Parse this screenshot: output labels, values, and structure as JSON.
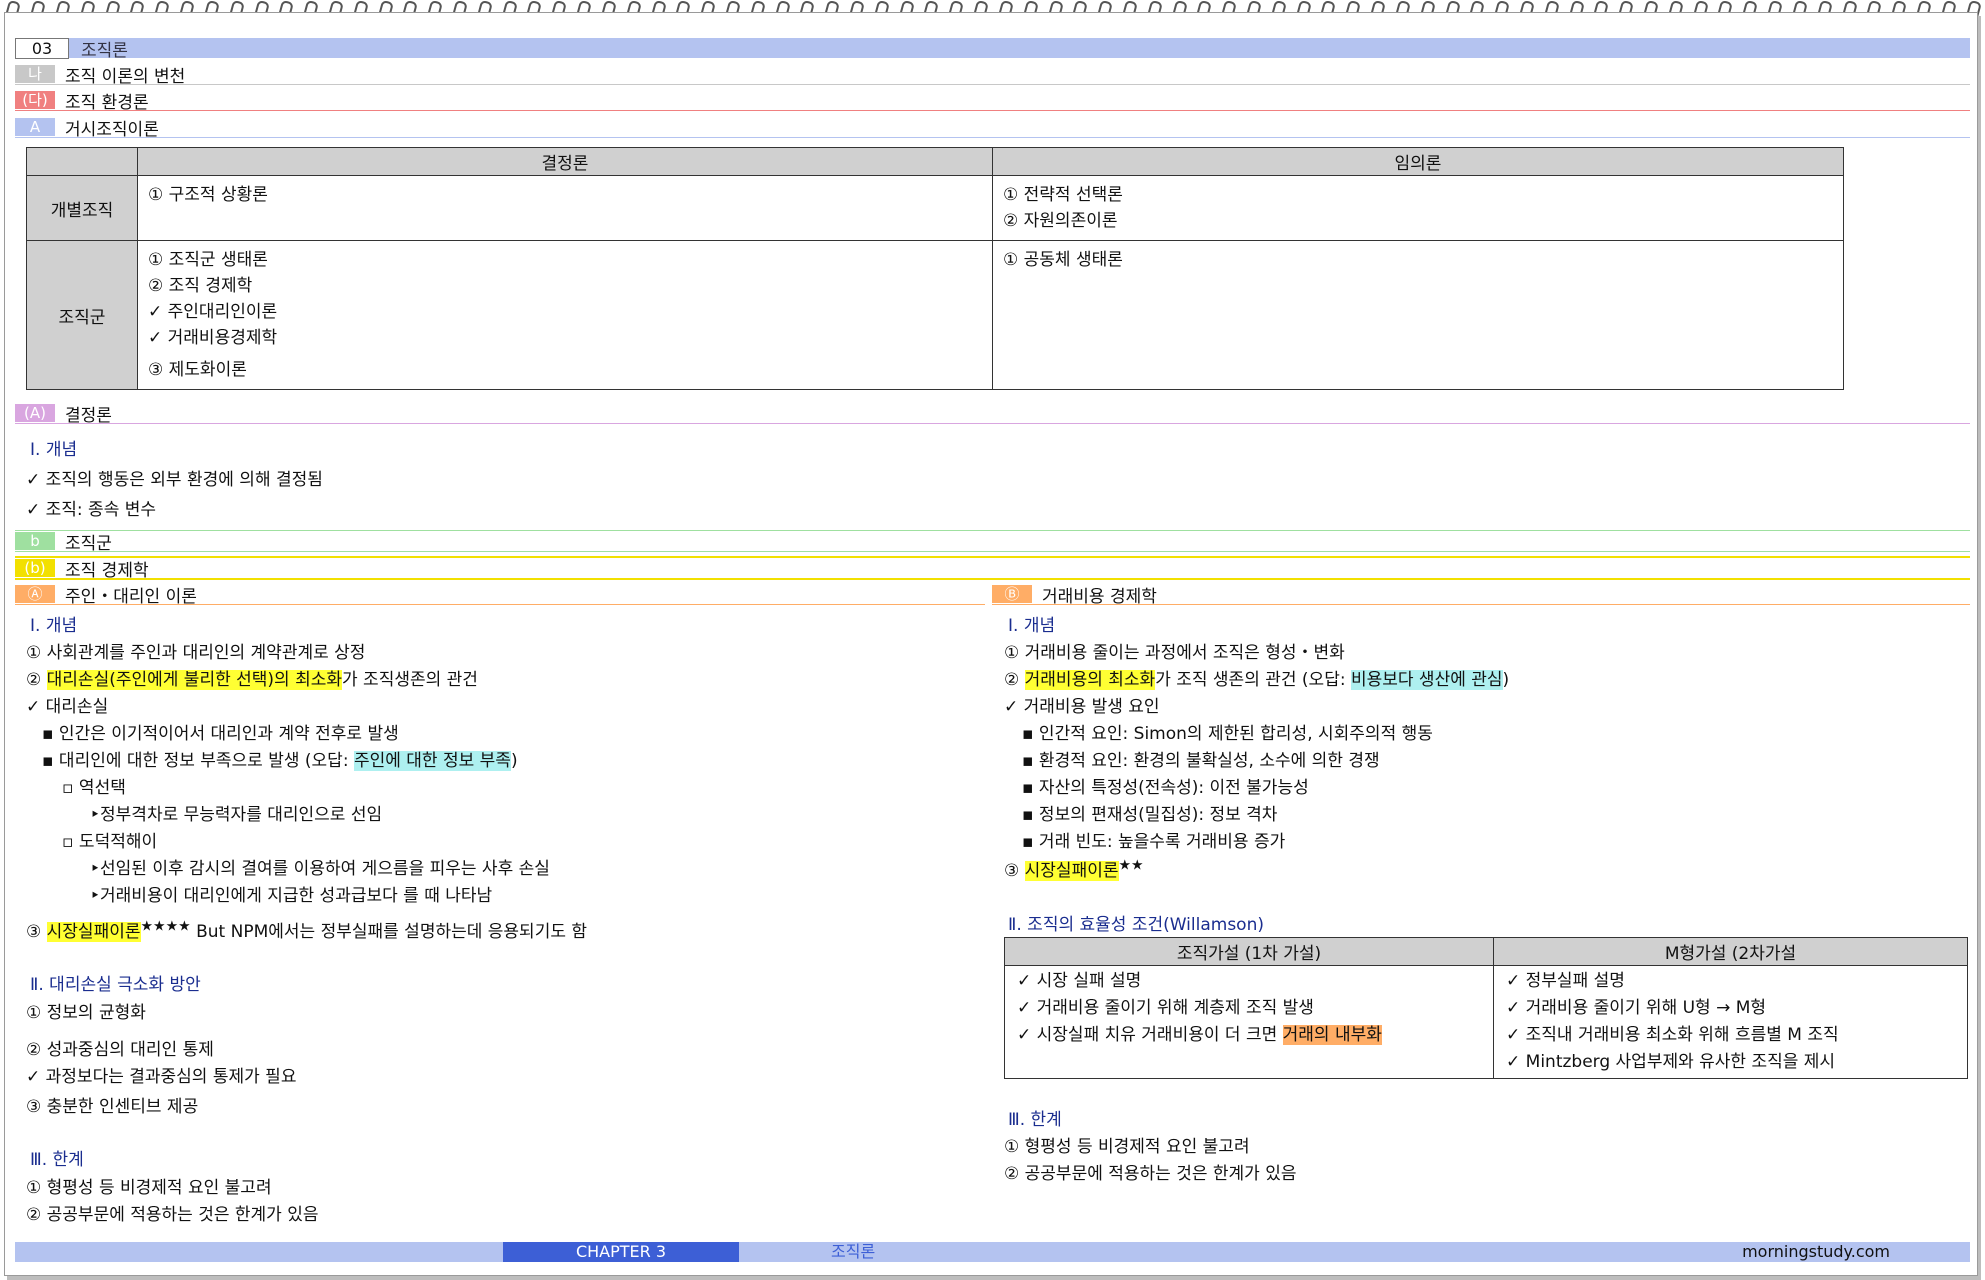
{
  "header": {
    "chapter_num": "03",
    "chapter_title": "조직론",
    "l2_tag": "나",
    "l2_title": "조직 이론의 변천",
    "l3_tag": "(다)",
    "l3_title": "조직 환경론",
    "l4_tag": "A",
    "l4_title": "거시조직이론"
  },
  "macro_table": {
    "col1": "결정론",
    "col2": "임의론",
    "row1_label": "개별조직",
    "row1_c1": [
      "① 구조적 상황론"
    ],
    "row1_c2": [
      "① 전략적 선택론",
      "② 자원의존이론"
    ],
    "row2_label": "조직군",
    "row2_c1": [
      "① 조직군 생태론",
      "② 조직 경제학",
      "✓ 주인대리인이론",
      "✓ 거래비용경제학",
      "③ 제도화이론"
    ],
    "row2_c2": [
      "① 공동체 생태론"
    ]
  },
  "determinism": {
    "tag": "(A)",
    "title": "결정론",
    "sec1": "Ⅰ. 개념",
    "items": [
      "✓ 조직의 행동은 외부 환경에 의해 결정됨",
      "✓ 조직: 종속 변수"
    ]
  },
  "popgroup": {
    "tag": "b",
    "title": "조직군"
  },
  "orgecon": {
    "tag": "(b)",
    "title": "조직 경제학"
  },
  "left": {
    "tag": "Ⓐ",
    "title": "주인・대리인 이론",
    "sec1": "Ⅰ. 개념",
    "l1": "① 사회관계를 주인과 대리인의 계약관계로 상정",
    "l2_pre": "② ",
    "l2_hl": "대리손실(주인에게 불리한 선택)의 최소화",
    "l2_post": "가 조직생존의 관건",
    "l3": "✓ 대리손실",
    "l4": "▪ 인간은 이기적이어서 대리인과 계약 전후로 발생",
    "l5_pre": "▪ 대리인에 대한 정보 부족으로 발생 (오답: ",
    "l5_hl": "주인에 대한 정보 부족",
    "l5_post": ")",
    "l6": "▫ 역선택",
    "l7": "‣정부격차로 무능력자를 대리인으로 선임",
    "l8": "▫ 도덕적해이",
    "l9": "‣선임된 이후 감시의 결여를 이용하여 게으름을 피우는 사후 손실",
    "l10": "‣거래비용이 대리인에게 지급한 성과급보다 를 때 나타남",
    "l11_pre": "③ ",
    "l11_hl": "시장실패이론",
    "l11_star": "★★★★",
    "l11_post": " But NPM에서는 정부실패를 설명하는데 응용되기도 함",
    "sec2": "Ⅱ. 대리손실 극소화 방안",
    "m1": "① 정보의 균형화",
    "m2": "② 성과중심의 대리인 통제",
    "m3": "✓ 과정보다는 결과중심의 통제가 필요",
    "m4": "③ 충분한 인센티브 제공",
    "sec3": "Ⅲ. 한계",
    "n1": "① 형평성 등 비경제적 요인 불고려",
    "n2": "② 공공부문에 적용하는 것은 한계가 있음"
  },
  "right": {
    "tag": "Ⓑ",
    "title": "거래비용 경제학",
    "sec1": "Ⅰ. 개념",
    "l1": "① 거래비용 줄이는 과정에서 조직은 형성・변화",
    "l2_pre": "② ",
    "l2_hl": "거래비용의 최소화",
    "l2_mid": "가 조직 생존의 관건 (오답: ",
    "l2_hl2": "비용보다 생산에 관심",
    "l2_post": ")",
    "l3": "✓ 거래비용 발생 요인",
    "l4": "▪ 인간적 요인: Simon의 제한된 합리성, 시회주의적 행동",
    "l5": "▪ 환경적 요인: 환경의 불확실성, 소수에 의한 경쟁",
    "l6": "▪ 자산의 특정성(전속성): 이전 불가능성",
    "l7": "▪ 정보의 편재성(밀집성): 정보 격차",
    "l8": "▪ 거래 빈도: 높을수록 거래비용 증가",
    "l9_pre": "③ ",
    "l9_hl": "시장실패이론",
    "l9_star": "★★",
    "sec2": "Ⅱ. 조직의 효율성 조건(Willamson)",
    "t_h1": "조직가설 (1차 가설)",
    "t_h2": "M형가설 (2차가설",
    "t_c1": [
      "✓ 시장 실패 설명",
      "✓ 거래비용 줄이기 위해 계층제 조직 발생"
    ],
    "t_c1_last_pre": "✓ 시장실패 치유 거래비용이 더 크면 ",
    "t_c1_last_hl": "거래의 내부화",
    "t_c2": [
      "✓ 정부실패 설명",
      "✓ 거래비용 줄이기 위해 U형 → M형",
      "✓ 조직내 거래비용 최소화 위해 흐름별 M 조직",
      "✓ Mintzberg 사업부제와 유사한 조직을 제시"
    ],
    "sec3": "Ⅲ. 한계",
    "n1": "① 형평성 등 비경제적 요인 불고려",
    "n2": "② 공공부문에 적용하는 것은 한계가 있음"
  },
  "footer": {
    "chapter": "CHAPTER 3",
    "title": "조직론",
    "site": "morningstudy.com"
  },
  "colors": {
    "blue_bar": "#b4c3f0",
    "gray_tag": "#c8c8c8",
    "pink_tag": "#f08080",
    "purple_tag": "#d9a6e0",
    "green_tag": "#9fe0a0",
    "yellow_bar": "#f2e000",
    "orange_tag": "#ffad66",
    "footer_dark": "#3d5fd6"
  }
}
